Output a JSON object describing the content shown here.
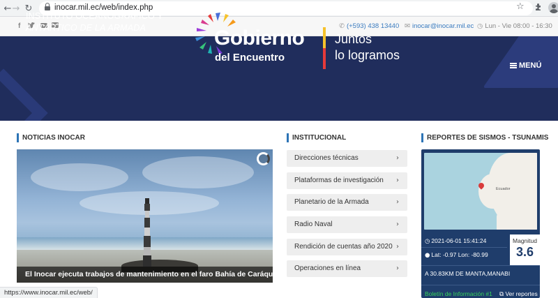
{
  "browser": {
    "url": "inocar.mil.ec/web/index.php",
    "status_url": "https://www.inocar.mil.ec/web/"
  },
  "topbar": {
    "phone": "(+593) 438 13440",
    "email": "inocar@inocar.mil.ec",
    "hours": "Lun - Vie 08:00 - 16:30"
  },
  "header": {
    "institution_line1": "INSTITUTO OCEANOGRÁFICO Y",
    "institution_line2": "ANTÁRTICO DE LA ARMADA",
    "gov_title": "Gobierno",
    "gov_subtitle": "del Encuentro",
    "slogan_line1": "Juntos",
    "slogan_line2": "lo logramos",
    "menu_label": "MENÚ"
  },
  "sections": {
    "news": "NOTICIAS INOCAR",
    "institutional": "INSTITUCIONAL",
    "seismic": "REPORTES DE SISMOS - TSUNAMIS"
  },
  "news": {
    "caption": "El Inocar ejecuta trabajos de mantenimiento en el faro Bahía de Caráquez"
  },
  "institutional": {
    "items": [
      "Direcciones técnicas",
      "Plataformas de investigación",
      "Planetario de la Armada",
      "Radio Naval",
      "Rendición de cuentas año 2020",
      "Operaciones en línea"
    ]
  },
  "seismic": {
    "map_label": "Ecuador",
    "datetime": "2021-06-01 15:41:24",
    "coords": "Lat: -0.97 Lon: -80.99",
    "magnitude_label": "Magnitud",
    "magnitude": "3.6",
    "location": "A 30.83KM DE MANTA,MANABI",
    "bulletin": "Boletín de Información #1",
    "view_reports": "Ver reportes"
  },
  "colors": {
    "banner": "#202d5c",
    "accent": "#2d74b6",
    "seismic_panel": "#1f3d6b",
    "bulletin_green": "#37d45c"
  }
}
